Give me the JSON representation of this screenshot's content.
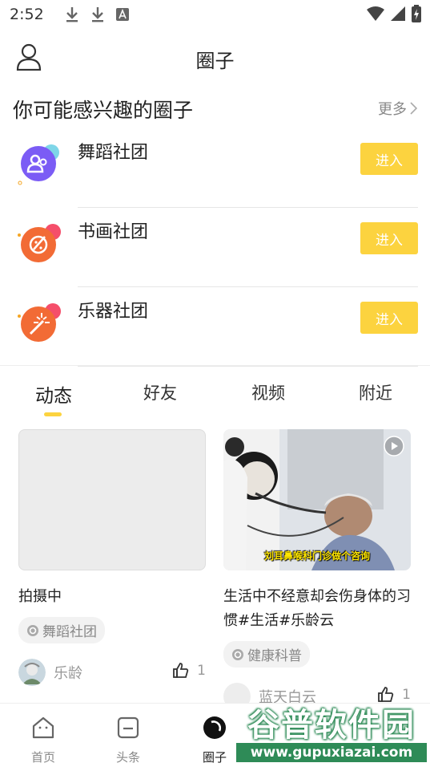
{
  "status_bar": {
    "time": "2:52"
  },
  "header": {
    "title": "圈子"
  },
  "recommend": {
    "title": "你可能感兴趣的圈子",
    "more_label": "更多",
    "circles": [
      {
        "name": "舞蹈社团",
        "button": "进入",
        "color": "#7b5cf5"
      },
      {
        "name": "书画社团",
        "button": "进入",
        "color": "#f26b35"
      },
      {
        "name": "乐器社团",
        "button": "进入",
        "color": "#f26b35"
      }
    ]
  },
  "tabs": [
    {
      "label": "动态",
      "active": true
    },
    {
      "label": "好友",
      "active": false
    },
    {
      "label": "视频",
      "active": false
    },
    {
      "label": "附近",
      "active": false
    }
  ],
  "feed": [
    {
      "caption": "拍摄中",
      "tag": "舞蹈社团",
      "author": "乐龄",
      "likes": "1"
    },
    {
      "caption": "生活中不经意却会伤身体的习惯#生活#乐龄云",
      "tag": "健康科普",
      "author": "蓝天白云",
      "likes": "1",
      "video_subtitle": "刘耳鼻喉科门诊做个咨询"
    }
  ],
  "bottom_nav": [
    {
      "label": "首页",
      "icon": "home-icon",
      "active": false
    },
    {
      "label": "头条",
      "icon": "headline-icon",
      "active": false
    },
    {
      "label": "圈子",
      "icon": "circle-icon",
      "active": true
    }
  ],
  "watermark": {
    "text": "谷普软件园",
    "url": "www.gupuxiazai.com"
  },
  "colors": {
    "accent": "#fcd33f",
    "watermark": "#2e8b57"
  }
}
